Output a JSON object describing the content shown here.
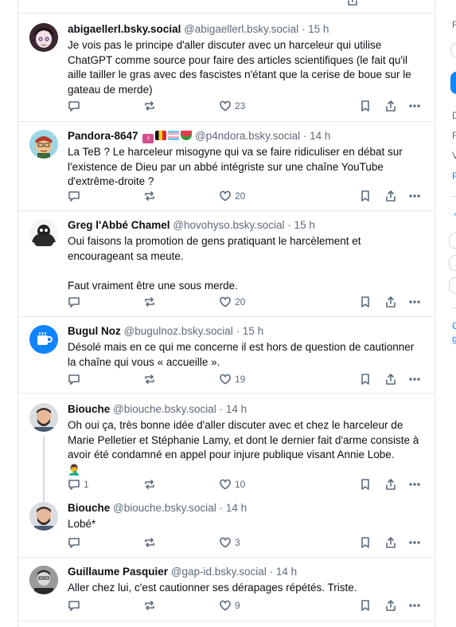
{
  "posts": [
    {
      "name": "abigaellerl.bsky.social",
      "handle": "@abigaellerl.bsky.social",
      "time": "· 15 h",
      "text": "Je vois pas le principe d'aller discuter avec un harceleur qui utilise ChatGPT comme source pour faire des articles scientifiques (le fait qu'il aille tailler le gras avec des fascistes n'étant que la cerise de boue sur le gateau de merde)",
      "replies": "",
      "likes": "23"
    },
    {
      "name": "Pandora-8647",
      "emoji": "♀️ 🇧🇪 🍉",
      "handle": "@p4ndora.bsky.social",
      "time": "· 14 h",
      "text": "La TeB ? Le harceleur misogyne qui va se faire ridiculiser en débat sur l'existence de Dieu par un abbé intégriste sur une chaîne YouTube d'extrême-droite ?",
      "replies": "",
      "likes": "20"
    },
    {
      "name": "Greg l'Abbé Chamel",
      "handle": "@hovohyso.bsky.social",
      "time": "· 15 h",
      "text": "Oui faisons la promotion de gens pratiquant le harcèlement et encourageant sa meute.\n\nFaut vraiment être une sous merde.",
      "replies": "",
      "likes": "20"
    },
    {
      "name": "Bugul Noz",
      "handle": "@bugulnoz.bsky.social",
      "time": "· 15 h",
      "text": "Désolé mais en ce qui me concerne il est hors de question de cautionner la chaîne qui vous « accueille ».",
      "replies": "",
      "likes": "19"
    },
    {
      "name": "Biouche",
      "handle": "@biouche.bsky.social",
      "time": "· 14 h",
      "text": "Oh oui ça, très bonne idée d'aller discuter avec et chez le harceleur de Marie Pelletier et Stéphanie Lamy, et dont le dernier fait d'arme consiste à avoir été condamné en appel pour injure publique visant Annie Lobe.",
      "emoji_line": "🤦‍♂️",
      "replies": "1",
      "likes": "10"
    },
    {
      "name": "Biouche",
      "handle": "@biouche.bsky.social",
      "time": "· 14 h",
      "text": "Lobé*",
      "replies": "",
      "likes": "3"
    },
    {
      "name": "Guillaume Pasquier",
      "handle": "@gap-id.bsky.social",
      "time": "· 14 h",
      "text": "Aller chez lui, c'est cautionner ses dérapages répétés. Triste.",
      "replies": "",
      "likes": "9"
    }
  ],
  "icons": {
    "reply": "reply-icon",
    "repost": "repost-icon",
    "like": "heart-icon",
    "bookmark": "bookmark-icon",
    "share": "share-icon",
    "more": "more-icon"
  },
  "colors": {
    "accent": "#1083fe",
    "muted": "#5d6b7c",
    "border": "#e3e8ee"
  },
  "sidebar_letters": [
    "F",
    "D",
    "F",
    "V",
    "F",
    "C",
    "g"
  ]
}
